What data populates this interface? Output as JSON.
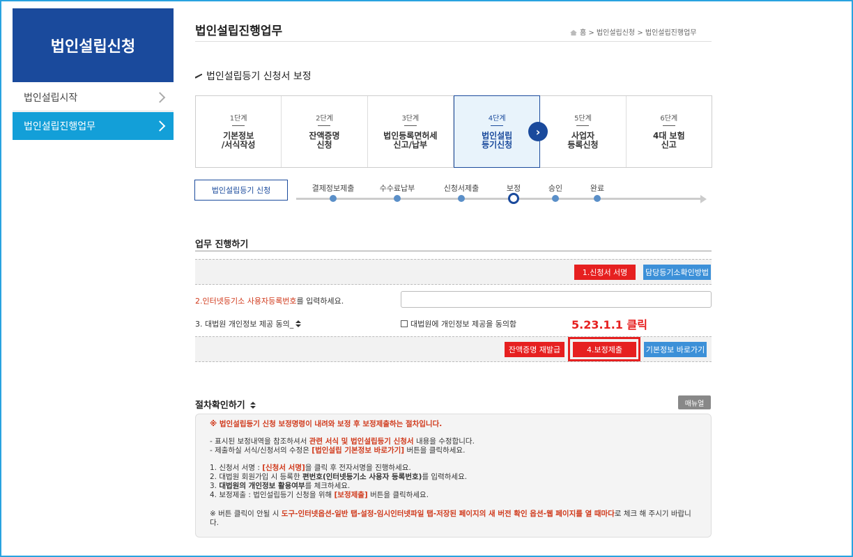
{
  "sidebar": {
    "title": "법인설립신청",
    "items": [
      {
        "label": "법인설립시작"
      },
      {
        "label": "법인설립진행업무"
      }
    ]
  },
  "header": {
    "title": "법인설립진행업무",
    "breadcrumb": "홈 > 법인설립신청 > 법인설립진행업무"
  },
  "section_title": "법인설립등기 신청서 보정",
  "steps": [
    {
      "num": "1단계",
      "name": "기본정보\n/서식작성"
    },
    {
      "num": "2단계",
      "name": "잔액증명\n신청"
    },
    {
      "num": "3단계",
      "name": "법인등록면허세\n신고/납부"
    },
    {
      "num": "4단계",
      "name": "법인설립\n등기신청"
    },
    {
      "num": "5단계",
      "name": "사업자\n등록신청"
    },
    {
      "num": "6단계",
      "name": "4대 보험\n신고"
    }
  ],
  "progress": {
    "current_box": "법인설립등기 신청",
    "steps": [
      "결제정보제출",
      "수수료납부",
      "신청서제출",
      "보정",
      "승인",
      "완료"
    ]
  },
  "work": {
    "title": "업무 진행하기",
    "sign_button": "1.신청서 서명",
    "registry_button": "담당등기소확인방법",
    "row2_highlight": "2.인터넷등기소 사용자등록번호",
    "row2_rest": "를 입력하세요.",
    "row3_label": "3. 대법원 개인정보 제공 동의_",
    "consent_label": "대법원에 개인정보 제공을 동의함",
    "annotation": "5.23.1.1 클릭",
    "reissue_button": "잔액증명 재발급",
    "submit_button": "4.보정제출",
    "basic_info_button": "기본정보 바로가기"
  },
  "procedure": {
    "title": "절차확인하기",
    "manual_button": "매뉴얼",
    "intro": "※ 법인설립등기 신청 보정명령이 내려와 보정 후 보정제출하는 절차입니다.",
    "line1_a": "- 표시된 보정내역을 참조하셔서 ",
    "line1_b": "관련 서식 및 법인설립등기 신청서",
    "line1_c": " 내용을 수정합니다.",
    "line2_a": "- 제출하실 서식/신청서의 수정은 ",
    "line2_b": "[법인설립 기본정보 바로가기]",
    "line2_c": " 버튼을 클릭하세요.",
    "step1_a": "1. 신청서 서명 : ",
    "step1_b": "[신청서 서명]",
    "step1_c": "을 클릭 후 전자서명을 진행하세요.",
    "step2_a": "2. 대법원 회원가입 시 등록한 ",
    "step2_b": "편번호(인터넷등기소 사용자 등록번호)",
    "step2_c": "를 입력하세요.",
    "step3_a": "3. ",
    "step3_b": "대법원의 개인정보 활용여부",
    "step3_c": "를 체크하세요.",
    "step4_a": "4. 보정제출 : 법인설립등기 신청을 위해 ",
    "step4_b": "[보정제출]",
    "step4_c": " 버튼을 클릭하세요.",
    "note_a": "※ 버튼 클릭이 안될 시 ",
    "note_b": "도구-인터넷옵션-일반 탭-설정-임시인터넷파일 탭-저장된 페이지의 새 버전 확인 옵션-웹 페이지를 열 때마다",
    "note_c": "로 체크 해 주시기 바랍니다."
  }
}
